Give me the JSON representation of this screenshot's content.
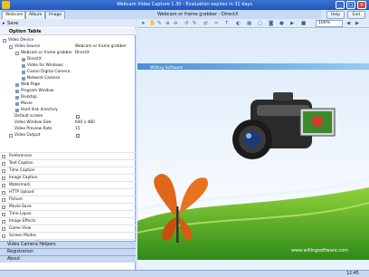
{
  "window": {
    "title": "Webcam Video Capture 1.30 - Evaluation expires in 31 days"
  },
  "tabs": [
    {
      "label": "Webcam"
    },
    {
      "label": "Album"
    },
    {
      "label": "Image"
    }
  ],
  "preview_title": "Webcam or frame grabber - DirectX",
  "top_buttons": {
    "help": "Help",
    "exit": "Exit"
  },
  "left": {
    "save_label": "Save",
    "option_table_label": "Option Table",
    "tree": [
      {
        "label": "Video Device",
        "value": ""
      },
      {
        "label": "Video Source",
        "value": "Webcam or frame grabber"
      },
      {
        "label": "Webcam or frame grabber",
        "value": "DirectX"
      },
      {
        "label": "DirectX",
        "value": ""
      },
      {
        "label": "Video for Windows",
        "value": ""
      },
      {
        "label": "Canon Digital Camera",
        "value": ""
      },
      {
        "label": "Network Camera",
        "value": ""
      },
      {
        "label": "Web Page",
        "value": ""
      },
      {
        "label": "Program Window",
        "value": ""
      },
      {
        "label": "Desktop",
        "value": ""
      },
      {
        "label": "Movie",
        "value": ""
      },
      {
        "label": "Hard disk directory",
        "value": ""
      },
      {
        "label": "Default screen",
        "value": ""
      },
      {
        "label": "Video Window Size",
        "value": "640 x 480"
      },
      {
        "label": "Video Preview Rate",
        "value": "15"
      },
      {
        "label": "Video Output",
        "value": ""
      }
    ],
    "sections": [
      "Preferences",
      "Text Caption",
      "Time Caption",
      "Image Caption",
      "Watermark",
      "HTTP Upload",
      "Picture",
      "Movie Save",
      "Time Lapse",
      "Image Effects",
      "Game View",
      "Screen Modes",
      "Management Kit"
    ],
    "bottom_tabs": [
      "Video Camera Helpers",
      "Registration",
      "About"
    ]
  },
  "toolbar": {
    "zoom_value": "100%"
  },
  "preview": {
    "brand": "Willing Software",
    "url": "www.willingsoftware.com"
  },
  "status": {
    "clock": "12:45"
  },
  "colors": {
    "accent": "#2a5cc0",
    "panel": "#d6e5f8"
  }
}
